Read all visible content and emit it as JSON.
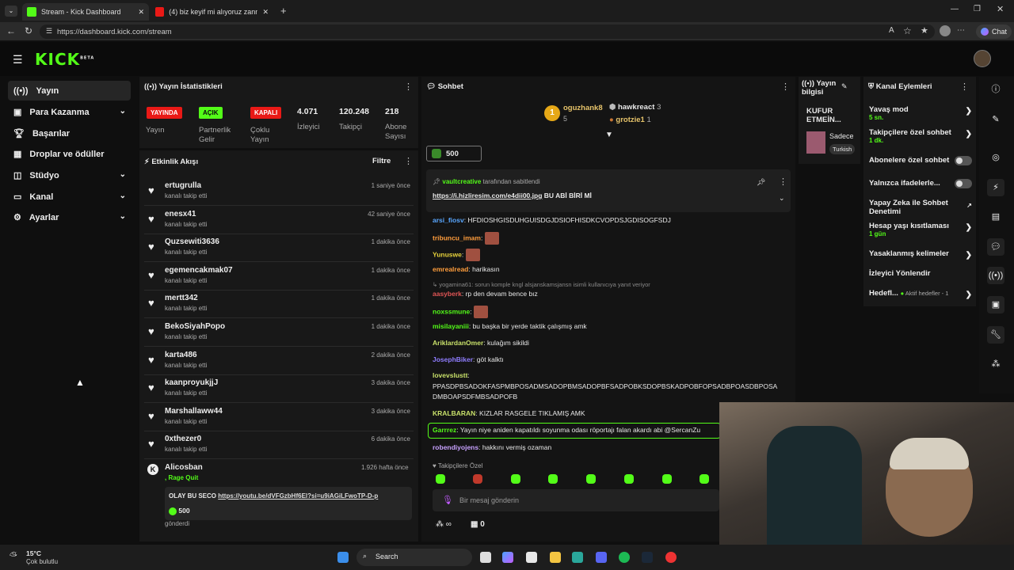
{
  "browser": {
    "tabs": [
      {
        "title": "Stream - Kick Dashboard"
      },
      {
        "title": "(4) biz keyif mi alıyoruz zannediyo"
      }
    ],
    "url": "https://dashboard.kick.com/stream",
    "chat_button": "Chat"
  },
  "header": {
    "logo": "KICK",
    "logo_beta": "BETA"
  },
  "sidebar": {
    "items": [
      {
        "label": "Yayın"
      },
      {
        "label": "Para Kazanma"
      },
      {
        "label": "Başarılar"
      },
      {
        "label": "Droplar ve ödüller"
      },
      {
        "label": "Stüdyo"
      },
      {
        "label": "Kanal"
      },
      {
        "label": "Ayarlar"
      }
    ]
  },
  "stats": {
    "title": "Yayın İstatistikleri",
    "badges": [
      {
        "text": "YAYINDA",
        "label": "Yayın",
        "color": "#e91916"
      },
      {
        "text": "AÇIK",
        "label": "Partnerlik Gelir",
        "color": "#53fc18"
      },
      {
        "text": "KAPALI",
        "label": "Çoklu Yayın",
        "color": "#e91916"
      }
    ],
    "values": [
      {
        "value": "4.071",
        "label": "İzleyici"
      },
      {
        "value": "120.248",
        "label": "Takipçi"
      },
      {
        "value": "218",
        "label": "Abone Sayısı"
      }
    ]
  },
  "activity": {
    "title": "Etkinlik Akışı",
    "filter": "Filtre",
    "items": [
      {
        "name": "ertugrulla",
        "sub": "kanalı takip etti",
        "time": "1 saniye önce"
      },
      {
        "name": "enesx41",
        "sub": "kanalı takip etti",
        "time": "42 saniye önce"
      },
      {
        "name": "Quzsewiti3636",
        "sub": "kanalı takip etti",
        "time": "1 dakika önce"
      },
      {
        "name": "egemencakmak07",
        "sub": "kanalı takip etti",
        "time": "1 dakika önce"
      },
      {
        "name": "mertt342",
        "sub": "kanalı takip etti",
        "time": "1 dakika önce"
      },
      {
        "name": "BekoSiyahPopo",
        "sub": "kanalı takip etti",
        "time": "1 dakika önce"
      },
      {
        "name": "karta486",
        "sub": "kanalı takip etti",
        "time": "2 dakika önce"
      },
      {
        "name": "kaanproyukjjJ",
        "sub": "kanalı takip etti",
        "time": "3 dakika önce"
      },
      {
        "name": "Marshallaww44",
        "sub": "kanalı takip etti",
        "time": "3 dakika önce"
      },
      {
        "name": "0xthezer0",
        "sub": "kanalı takip etti",
        "time": "6 dakika önce"
      }
    ],
    "last": {
      "name": "Alicosban",
      "sub": ", Rage Quit",
      "time": "1.926 hafta önce",
      "msg_prefix": "OLAY BU SECO",
      "link": "https://youtu.be/dVFGzbHf6El?si=u9iAGiLFwoTP-D-p",
      "amount": "500",
      "sent": "gönderdi"
    }
  },
  "chat": {
    "title": "Sohbet",
    "top": [
      {
        "name": "oguzhank8",
        "value": "5"
      },
      {
        "name": "hawkreact",
        "value": "3"
      },
      {
        "name": "grotzie1",
        "value": "1"
      }
    ],
    "rank": "1",
    "pill": "500",
    "pinned_by": "vaultcreative",
    "pinned_suffix": "tarafından sabitlendi",
    "pinned_link": "https://i.hizliresim.com/e4dii00.jpg",
    "pinned_text": "BU ABİ BİRİ Mİ",
    "messages": [
      {
        "user": "arsi_fiosv",
        "text": ": HFDIOSHGISDUHGUISDGJDSIOFHISDKCVOPDSJGDISOGFSDJ",
        "color": "#59a7ff"
      },
      {
        "user": "tribuncu_imam",
        "text": ":",
        "color": "#ff9d3c",
        "emote": true
      },
      {
        "user": "Yunuswe",
        "text": ":",
        "color": "#e6d13b",
        "emote": true
      },
      {
        "user": "emrealread",
        "text": ": harikasın",
        "color": "#ff9d3c"
      },
      {
        "user": "reply",
        "text": "yogamina61: sorun komple kngl alsjanskamsjansn isimli kullanıcıya yanıt veriyor",
        "color": "#888"
      },
      {
        "user": "aasyberk",
        "text": ": rp den devam bence bız",
        "color": "#e05555"
      },
      {
        "user": "noxssmune",
        "text": ":",
        "color": "#53fc18",
        "emote": true
      },
      {
        "user": "misilayaniii",
        "text": ": bu başka bir yerde taktik çalışmış amk",
        "color": "#53fc18"
      },
      {
        "user": "AriklardanOmer",
        "text": ": kulağım sikildi",
        "color": "#c8e06a"
      },
      {
        "user": "JosephBiker",
        "text": ": göt kalktı",
        "color": "#8f7dff"
      },
      {
        "user": "lovevslustt",
        "text": ":",
        "color": "#c8e06a"
      },
      {
        "user": "",
        "text": "PPASDPBSADOKFASPMBPOSADMSADOPBMSADOPBFSADPOBKSDOPBSKADPOBFOPSADBPOASDBPOSA",
        "color": "#eee"
      },
      {
        "user": "",
        "text": "DMBOAPSDFMBSADPOFB",
        "color": "#eee"
      },
      {
        "user": "KRALBARAN",
        "text": ": KIZLAR RASGELE TIKLAMIŞ AMK",
        "color": "#c8e06a"
      },
      {
        "user": "Garrrez",
        "text": ": Yayın niye aniden kapatıldı soyunma odası röportajı falan akardı abi @SercanZu",
        "color": "#53fc18"
      },
      {
        "user": "robendiyojens",
        "text": ": hakkını vermiş ozaman",
        "color": "#c8a2ff"
      }
    ],
    "followers_only": "Takipçilere Özel",
    "input_placeholder": "Bir mesaj gönderin",
    "footer_count": "0"
  },
  "stream_info": {
    "title": "Yayın bilgisi",
    "heading": "KUFUR ETMEİN...",
    "preview": "Sadece",
    "tag": "Turkish"
  },
  "channel_actions": {
    "title": "Kanal Eylemleri",
    "items": [
      {
        "label": "Yavaş mod",
        "sub": "5 sn."
      },
      {
        "label": "Takipçilere özel sohbet",
        "sub": "1 dk."
      },
      {
        "label": "Abonelere özel sohbet",
        "sub": ""
      },
      {
        "label": "Yalnızca ifadelerle...",
        "sub": ""
      },
      {
        "label": "Yapay Zeka ile Sohbet Denetimi",
        "sub": ""
      },
      {
        "label": "Hesap yaşı kısıtlaması",
        "sub": "1 gün"
      },
      {
        "label": "Yasaklanmış kelimeler",
        "sub": ""
      },
      {
        "label": "İzleyici Yönlendir",
        "sub": ""
      },
      {
        "label": "Hedefl...",
        "sub": "Aktif hedefler - 1"
      }
    ]
  },
  "taskbar": {
    "temp": "15°C",
    "weather": "Çok bulutlu",
    "search": "Search"
  }
}
